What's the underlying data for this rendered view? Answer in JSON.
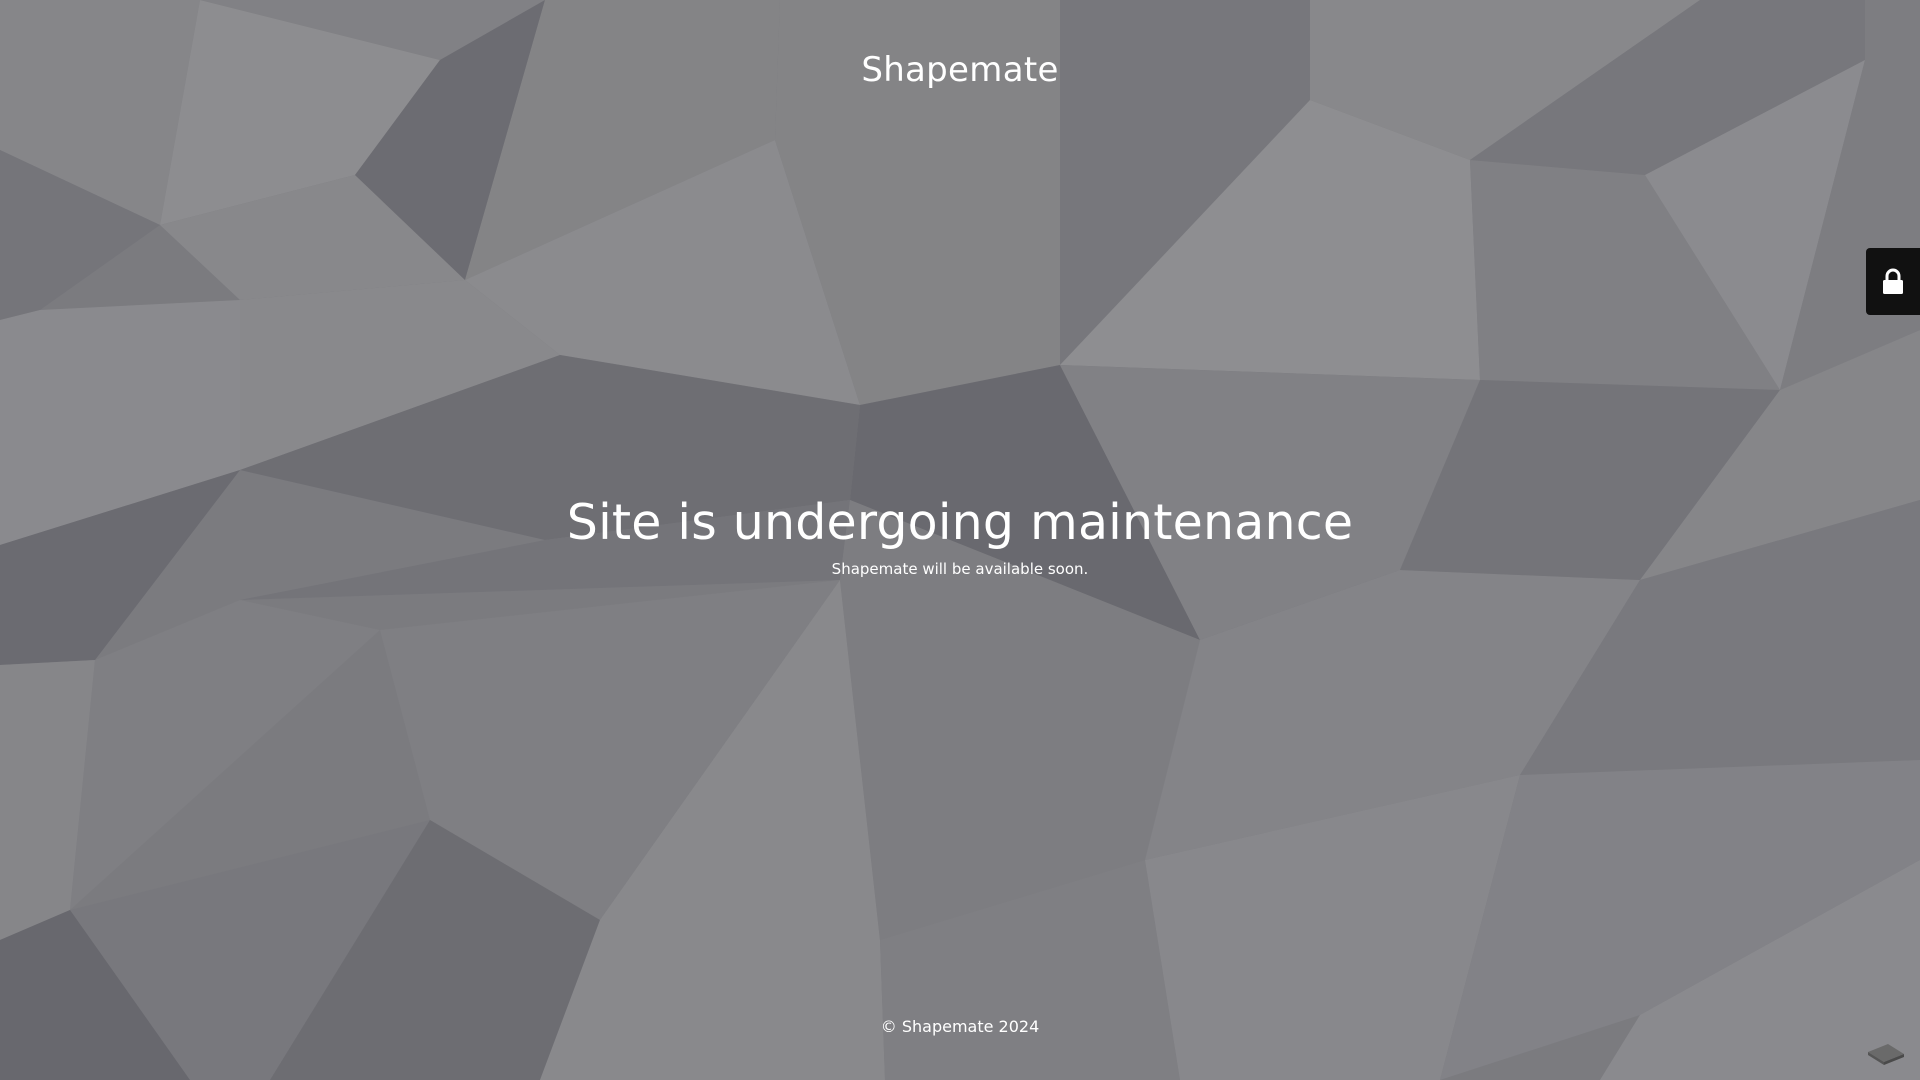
{
  "header": {
    "site_name": "Shapemate"
  },
  "main": {
    "headline": "Site is undergoing maintenance",
    "subtext": "Shapemate will be available soon."
  },
  "footer": {
    "copyright": "© Shapemate 2024"
  },
  "icons": {
    "lock": "lock-icon",
    "corner": "corner-badge-icon"
  },
  "colors": {
    "text": "#ffffff",
    "background": "#7e7e82",
    "lock_tab": "#111111"
  }
}
